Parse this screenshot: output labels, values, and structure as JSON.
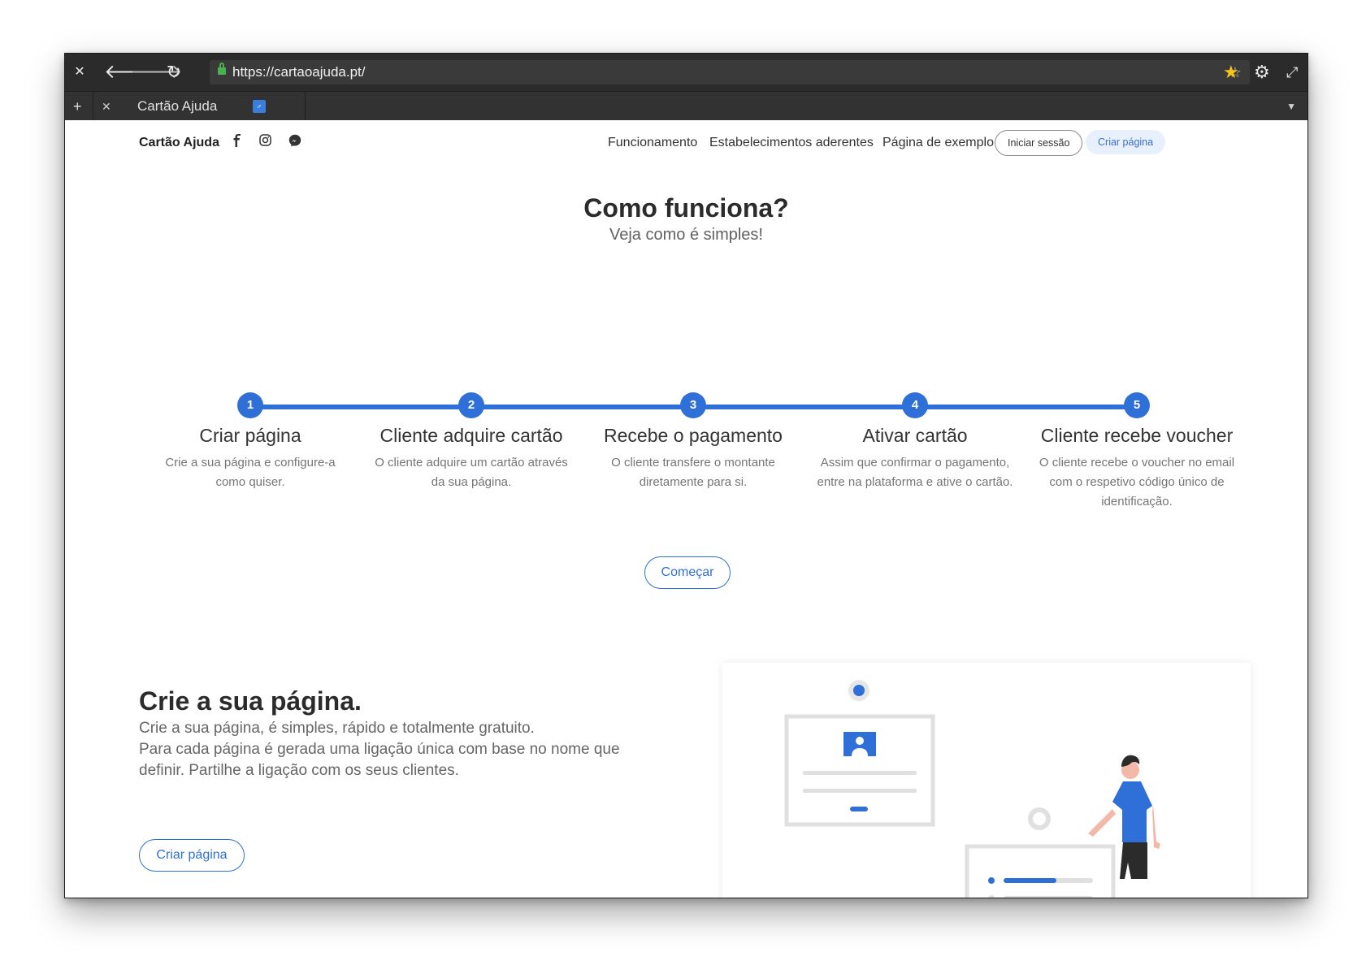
{
  "browser": {
    "url": "https://cartaoajuda.pt/",
    "tab_title": "Cartão Ajuda",
    "favicon_text": "♂"
  },
  "colors": {
    "accent": "#2e6fd8",
    "titlebar": "#2b2b2b",
    "star": "#f5c518"
  },
  "nav": {
    "brand": "Cartão Ajuda",
    "social_icons": [
      "facebook-icon",
      "instagram-icon",
      "messenger-icon"
    ],
    "links": [
      "Funcionamento",
      "Estabelecimentos aderentes",
      "Página de exemplo"
    ],
    "login": "Iniciar sessão",
    "create": "Criar página"
  },
  "how": {
    "title": "Como funciona?",
    "subtitle": "Veja como é simples!",
    "steps": [
      {
        "num": "1",
        "title": "Criar página",
        "desc": "Crie a sua página e configure-a como quiser."
      },
      {
        "num": "2",
        "title": "Cliente adquire cartão",
        "desc": "O cliente adquire um cartão através da sua página."
      },
      {
        "num": "3",
        "title": "Recebe o pagamento",
        "desc": "O cliente transfere o montante diretamente para si."
      },
      {
        "num": "4",
        "title": "Ativar cartão",
        "desc": "Assim que confirmar o pagamento, entre na plataforma e ative o cartão."
      },
      {
        "num": "5",
        "title": "Cliente recebe voucher",
        "desc": "O cliente recebe o voucher no email com o respetivo código único de identificação."
      }
    ],
    "cta": "Começar"
  },
  "hero": {
    "title": "Crie a sua página.",
    "line1": "Crie a sua página, é simples, rápido e totalmente gratuito.",
    "line2": "Para cada página é gerada uma ligação única com base no nome que definir. Partilhe a ligação com os seus clientes.",
    "button": "Criar página"
  }
}
